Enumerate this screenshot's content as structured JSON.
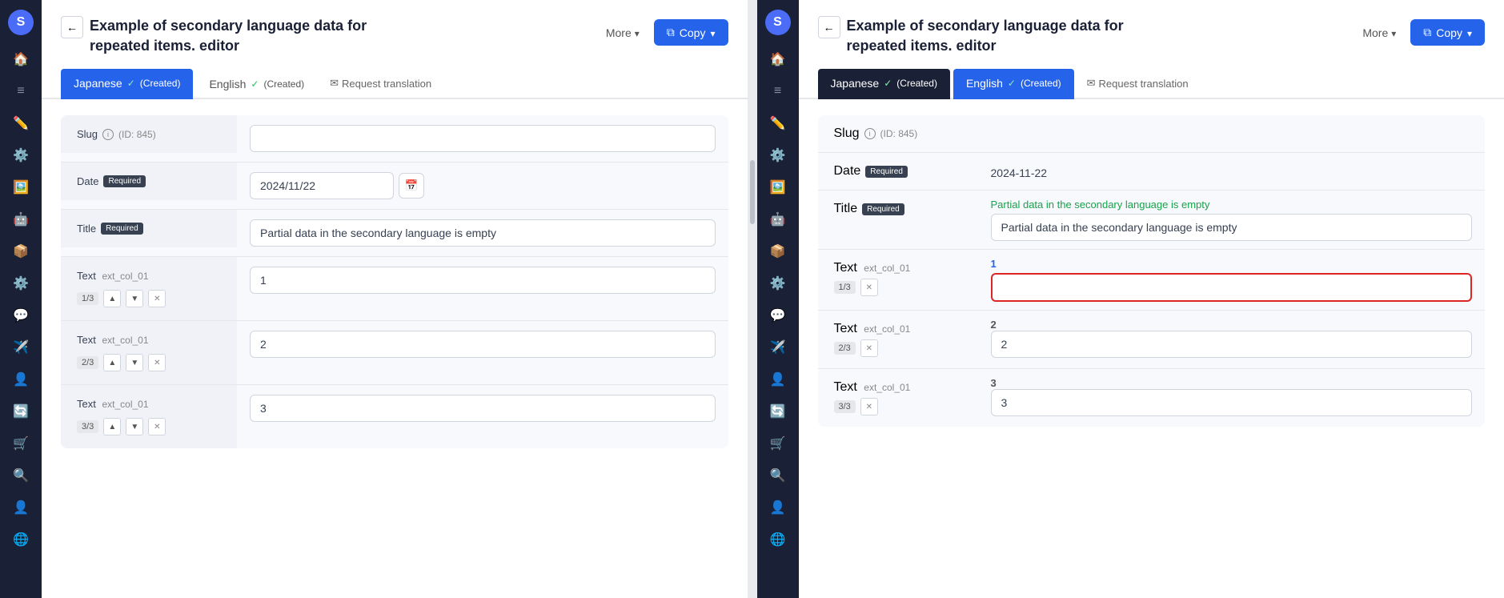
{
  "sidebar_left": {
    "icons": [
      "🏠",
      "📋",
      "✏️",
      "⚙️",
      "🖼️",
      "🤖",
      "📦",
      "⚙️",
      "💬",
      "✈️",
      "👤",
      "🔄",
      "🛒",
      "🔍",
      "👤",
      "⊕"
    ]
  },
  "sidebar_right": {
    "icons": [
      "🏠",
      "📋",
      "✏️",
      "⚙️",
      "🖼️",
      "🤖",
      "📦",
      "⚙️",
      "💬",
      "✈️",
      "👤",
      "🔄",
      "🛒",
      "🔍",
      "👤",
      "⊕"
    ]
  },
  "panel_left": {
    "header": {
      "title": "Example of secondary language data for repeated items. editor",
      "back_label": "←",
      "more_label": "More",
      "copy_label": "Copy"
    },
    "tabs": [
      {
        "label": "Japanese",
        "status": "✓ (Created)",
        "active": true
      },
      {
        "label": "English",
        "status": "✓ (Created)",
        "active": false
      },
      {
        "label": "Request translation",
        "active": false,
        "is_request": true
      }
    ],
    "form": {
      "slug": {
        "label": "Slug",
        "id_text": "(ID: 845)",
        "value": ""
      },
      "date": {
        "label": "Date",
        "required": true,
        "value": "2024/11/22"
      },
      "title": {
        "label": "Title",
        "required": true,
        "value": "Partial data in the secondary language is empty"
      },
      "text_fields": [
        {
          "label": "Text",
          "sub": "ext_col_01",
          "counter": "1/3",
          "value": "1"
        },
        {
          "label": "Text",
          "sub": "ext_col_01",
          "counter": "2/3",
          "value": "2"
        },
        {
          "label": "Text",
          "sub": "ext_col_01",
          "counter": "3/3",
          "value": "3"
        }
      ]
    }
  },
  "panel_right": {
    "header": {
      "title": "Example of secondary language data for repeated items. editor",
      "back_label": "←",
      "more_label": "More",
      "copy_label": "Copy"
    },
    "tabs": [
      {
        "label": "Japanese",
        "status": "✓ (Created)",
        "active": false
      },
      {
        "label": "English",
        "status": "✓ (Created)",
        "active": true
      },
      {
        "label": "Request translation",
        "active": false,
        "is_request": true
      }
    ],
    "form": {
      "slug": {
        "label": "Slug",
        "id_text": "(ID: 845)",
        "value": ""
      },
      "date": {
        "label": "Date",
        "required": true,
        "value": "2024-11-22"
      },
      "title": {
        "label": "Title",
        "required": true,
        "warning": "Partial data in the secondary language is empty",
        "value": "Partial data in the secondary language is empty"
      },
      "text_fields": [
        {
          "label": "Text",
          "sub": "ext_col_01",
          "counter": "1/3",
          "value": "",
          "index": "1",
          "highlighted": true
        },
        {
          "label": "Text",
          "sub": "ext_col_01",
          "counter": "2/3",
          "value": "2",
          "index": "2",
          "highlighted": false
        },
        {
          "label": "Text",
          "sub": "ext_col_01",
          "counter": "3/3",
          "value": "3",
          "index": "3",
          "highlighted": false
        }
      ]
    }
  }
}
